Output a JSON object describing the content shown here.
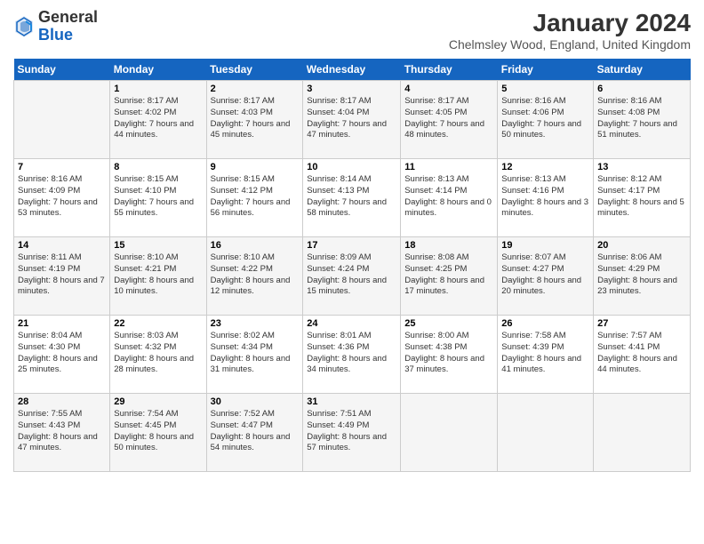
{
  "logo": {
    "general": "General",
    "blue": "Blue"
  },
  "header": {
    "title": "January 2024",
    "location": "Chelmsley Wood, England, United Kingdom"
  },
  "weekdays": [
    "Sunday",
    "Monday",
    "Tuesday",
    "Wednesday",
    "Thursday",
    "Friday",
    "Saturday"
  ],
  "weeks": [
    [
      {
        "day": "",
        "sunrise": "",
        "sunset": "",
        "daylight": ""
      },
      {
        "day": "1",
        "sunrise": "Sunrise: 8:17 AM",
        "sunset": "Sunset: 4:02 PM",
        "daylight": "Daylight: 7 hours and 44 minutes."
      },
      {
        "day": "2",
        "sunrise": "Sunrise: 8:17 AM",
        "sunset": "Sunset: 4:03 PM",
        "daylight": "Daylight: 7 hours and 45 minutes."
      },
      {
        "day": "3",
        "sunrise": "Sunrise: 8:17 AM",
        "sunset": "Sunset: 4:04 PM",
        "daylight": "Daylight: 7 hours and 47 minutes."
      },
      {
        "day": "4",
        "sunrise": "Sunrise: 8:17 AM",
        "sunset": "Sunset: 4:05 PM",
        "daylight": "Daylight: 7 hours and 48 minutes."
      },
      {
        "day": "5",
        "sunrise": "Sunrise: 8:16 AM",
        "sunset": "Sunset: 4:06 PM",
        "daylight": "Daylight: 7 hours and 50 minutes."
      },
      {
        "day": "6",
        "sunrise": "Sunrise: 8:16 AM",
        "sunset": "Sunset: 4:08 PM",
        "daylight": "Daylight: 7 hours and 51 minutes."
      }
    ],
    [
      {
        "day": "7",
        "sunrise": "Sunrise: 8:16 AM",
        "sunset": "Sunset: 4:09 PM",
        "daylight": "Daylight: 7 hours and 53 minutes."
      },
      {
        "day": "8",
        "sunrise": "Sunrise: 8:15 AM",
        "sunset": "Sunset: 4:10 PM",
        "daylight": "Daylight: 7 hours and 55 minutes."
      },
      {
        "day": "9",
        "sunrise": "Sunrise: 8:15 AM",
        "sunset": "Sunset: 4:12 PM",
        "daylight": "Daylight: 7 hours and 56 minutes."
      },
      {
        "day": "10",
        "sunrise": "Sunrise: 8:14 AM",
        "sunset": "Sunset: 4:13 PM",
        "daylight": "Daylight: 7 hours and 58 minutes."
      },
      {
        "day": "11",
        "sunrise": "Sunrise: 8:13 AM",
        "sunset": "Sunset: 4:14 PM",
        "daylight": "Daylight: 8 hours and 0 minutes."
      },
      {
        "day": "12",
        "sunrise": "Sunrise: 8:13 AM",
        "sunset": "Sunset: 4:16 PM",
        "daylight": "Daylight: 8 hours and 3 minutes."
      },
      {
        "day": "13",
        "sunrise": "Sunrise: 8:12 AM",
        "sunset": "Sunset: 4:17 PM",
        "daylight": "Daylight: 8 hours and 5 minutes."
      }
    ],
    [
      {
        "day": "14",
        "sunrise": "Sunrise: 8:11 AM",
        "sunset": "Sunset: 4:19 PM",
        "daylight": "Daylight: 8 hours and 7 minutes."
      },
      {
        "day": "15",
        "sunrise": "Sunrise: 8:10 AM",
        "sunset": "Sunset: 4:21 PM",
        "daylight": "Daylight: 8 hours and 10 minutes."
      },
      {
        "day": "16",
        "sunrise": "Sunrise: 8:10 AM",
        "sunset": "Sunset: 4:22 PM",
        "daylight": "Daylight: 8 hours and 12 minutes."
      },
      {
        "day": "17",
        "sunrise": "Sunrise: 8:09 AM",
        "sunset": "Sunset: 4:24 PM",
        "daylight": "Daylight: 8 hours and 15 minutes."
      },
      {
        "day": "18",
        "sunrise": "Sunrise: 8:08 AM",
        "sunset": "Sunset: 4:25 PM",
        "daylight": "Daylight: 8 hours and 17 minutes."
      },
      {
        "day": "19",
        "sunrise": "Sunrise: 8:07 AM",
        "sunset": "Sunset: 4:27 PM",
        "daylight": "Daylight: 8 hours and 20 minutes."
      },
      {
        "day": "20",
        "sunrise": "Sunrise: 8:06 AM",
        "sunset": "Sunset: 4:29 PM",
        "daylight": "Daylight: 8 hours and 23 minutes."
      }
    ],
    [
      {
        "day": "21",
        "sunrise": "Sunrise: 8:04 AM",
        "sunset": "Sunset: 4:30 PM",
        "daylight": "Daylight: 8 hours and 25 minutes."
      },
      {
        "day": "22",
        "sunrise": "Sunrise: 8:03 AM",
        "sunset": "Sunset: 4:32 PM",
        "daylight": "Daylight: 8 hours and 28 minutes."
      },
      {
        "day": "23",
        "sunrise": "Sunrise: 8:02 AM",
        "sunset": "Sunset: 4:34 PM",
        "daylight": "Daylight: 8 hours and 31 minutes."
      },
      {
        "day": "24",
        "sunrise": "Sunrise: 8:01 AM",
        "sunset": "Sunset: 4:36 PM",
        "daylight": "Daylight: 8 hours and 34 minutes."
      },
      {
        "day": "25",
        "sunrise": "Sunrise: 8:00 AM",
        "sunset": "Sunset: 4:38 PM",
        "daylight": "Daylight: 8 hours and 37 minutes."
      },
      {
        "day": "26",
        "sunrise": "Sunrise: 7:58 AM",
        "sunset": "Sunset: 4:39 PM",
        "daylight": "Daylight: 8 hours and 41 minutes."
      },
      {
        "day": "27",
        "sunrise": "Sunrise: 7:57 AM",
        "sunset": "Sunset: 4:41 PM",
        "daylight": "Daylight: 8 hours and 44 minutes."
      }
    ],
    [
      {
        "day": "28",
        "sunrise": "Sunrise: 7:55 AM",
        "sunset": "Sunset: 4:43 PM",
        "daylight": "Daylight: 8 hours and 47 minutes."
      },
      {
        "day": "29",
        "sunrise": "Sunrise: 7:54 AM",
        "sunset": "Sunset: 4:45 PM",
        "daylight": "Daylight: 8 hours and 50 minutes."
      },
      {
        "day": "30",
        "sunrise": "Sunrise: 7:52 AM",
        "sunset": "Sunset: 4:47 PM",
        "daylight": "Daylight: 8 hours and 54 minutes."
      },
      {
        "day": "31",
        "sunrise": "Sunrise: 7:51 AM",
        "sunset": "Sunset: 4:49 PM",
        "daylight": "Daylight: 8 hours and 57 minutes."
      },
      {
        "day": "",
        "sunrise": "",
        "sunset": "",
        "daylight": ""
      },
      {
        "day": "",
        "sunrise": "",
        "sunset": "",
        "daylight": ""
      },
      {
        "day": "",
        "sunrise": "",
        "sunset": "",
        "daylight": ""
      }
    ]
  ]
}
